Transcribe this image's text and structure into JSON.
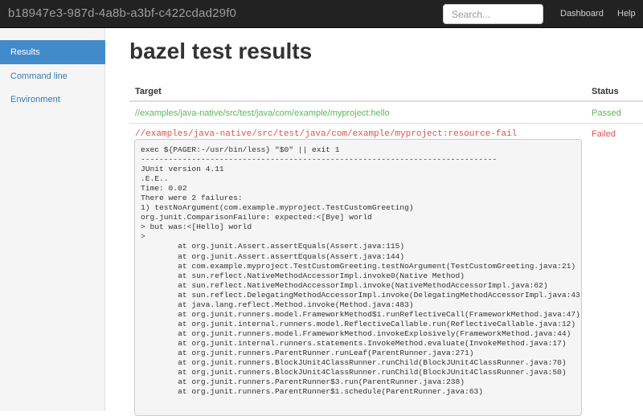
{
  "navbar": {
    "brand": "b18947e3-987d-4a8b-a3bf-c422cdad29f0",
    "search_placeholder": "Search...",
    "links": [
      "Dashboard",
      "Help"
    ]
  },
  "sidebar": {
    "items": [
      {
        "label": "Results",
        "active": true
      },
      {
        "label": "Command line",
        "active": false
      },
      {
        "label": "Environment",
        "active": false
      }
    ]
  },
  "main": {
    "title": "bazel test results",
    "columns": [
      "Target",
      "Status"
    ],
    "rows": [
      {
        "target": "//examples/java-native/src/test/java/com/example/myproject:hello",
        "status": "Passed"
      },
      {
        "target": "//examples/java-native/src/test/java/com/example/myproject:resource-fail",
        "status": "Failed"
      }
    ],
    "log": "exec ${PAGER:-/usr/bin/less} \"$0\" || exit 1\n-----------------------------------------------------------------------------\nJUnit version 4.11\n.E.E..\nTime: 0.02\nThere were 2 failures:\n1) testNoArgument(com.example.myproject.TestCustomGreeting)\norg.junit.ComparisonFailure: expected:<[Bye] world\n> but was:<[Hello] world\n>\n\tat org.junit.Assert.assertEquals(Assert.java:115)\n\tat org.junit.Assert.assertEquals(Assert.java:144)\n\tat com.example.myproject.TestCustomGreeting.testNoArgument(TestCustomGreeting.java:21)\n\tat sun.reflect.NativeMethodAccessorImpl.invoke0(Native Method)\n\tat sun.reflect.NativeMethodAccessorImpl.invoke(NativeMethodAccessorImpl.java:62)\n\tat sun.reflect.DelegatingMethodAccessorImpl.invoke(DelegatingMethodAccessorImpl.java:43)\n\tat java.lang.reflect.Method.invoke(Method.java:483)\n\tat org.junit.runners.model.FrameworkMethod$1.runReflectiveCall(FrameworkMethod.java:47)\n\tat org.junit.internal.runners.model.ReflectiveCallable.run(ReflectiveCallable.java:12)\n\tat org.junit.runners.model.FrameworkMethod.invokeExplosively(FrameworkMethod.java:44)\n\tat org.junit.internal.runners.statements.InvokeMethod.evaluate(InvokeMethod.java:17)\n\tat org.junit.runners.ParentRunner.runLeaf(ParentRunner.java:271)\n\tat org.junit.runners.BlockJUnit4ClassRunner.runChild(BlockJUnit4ClassRunner.java:70)\n\tat org.junit.runners.BlockJUnit4ClassRunner.runChild(BlockJUnit4ClassRunner.java:50)\n\tat org.junit.runners.ParentRunner$3.run(ParentRunner.java:238)\n\tat org.junit.runners.ParentRunner$1.schedule(ParentRunner.java:63)"
  }
}
